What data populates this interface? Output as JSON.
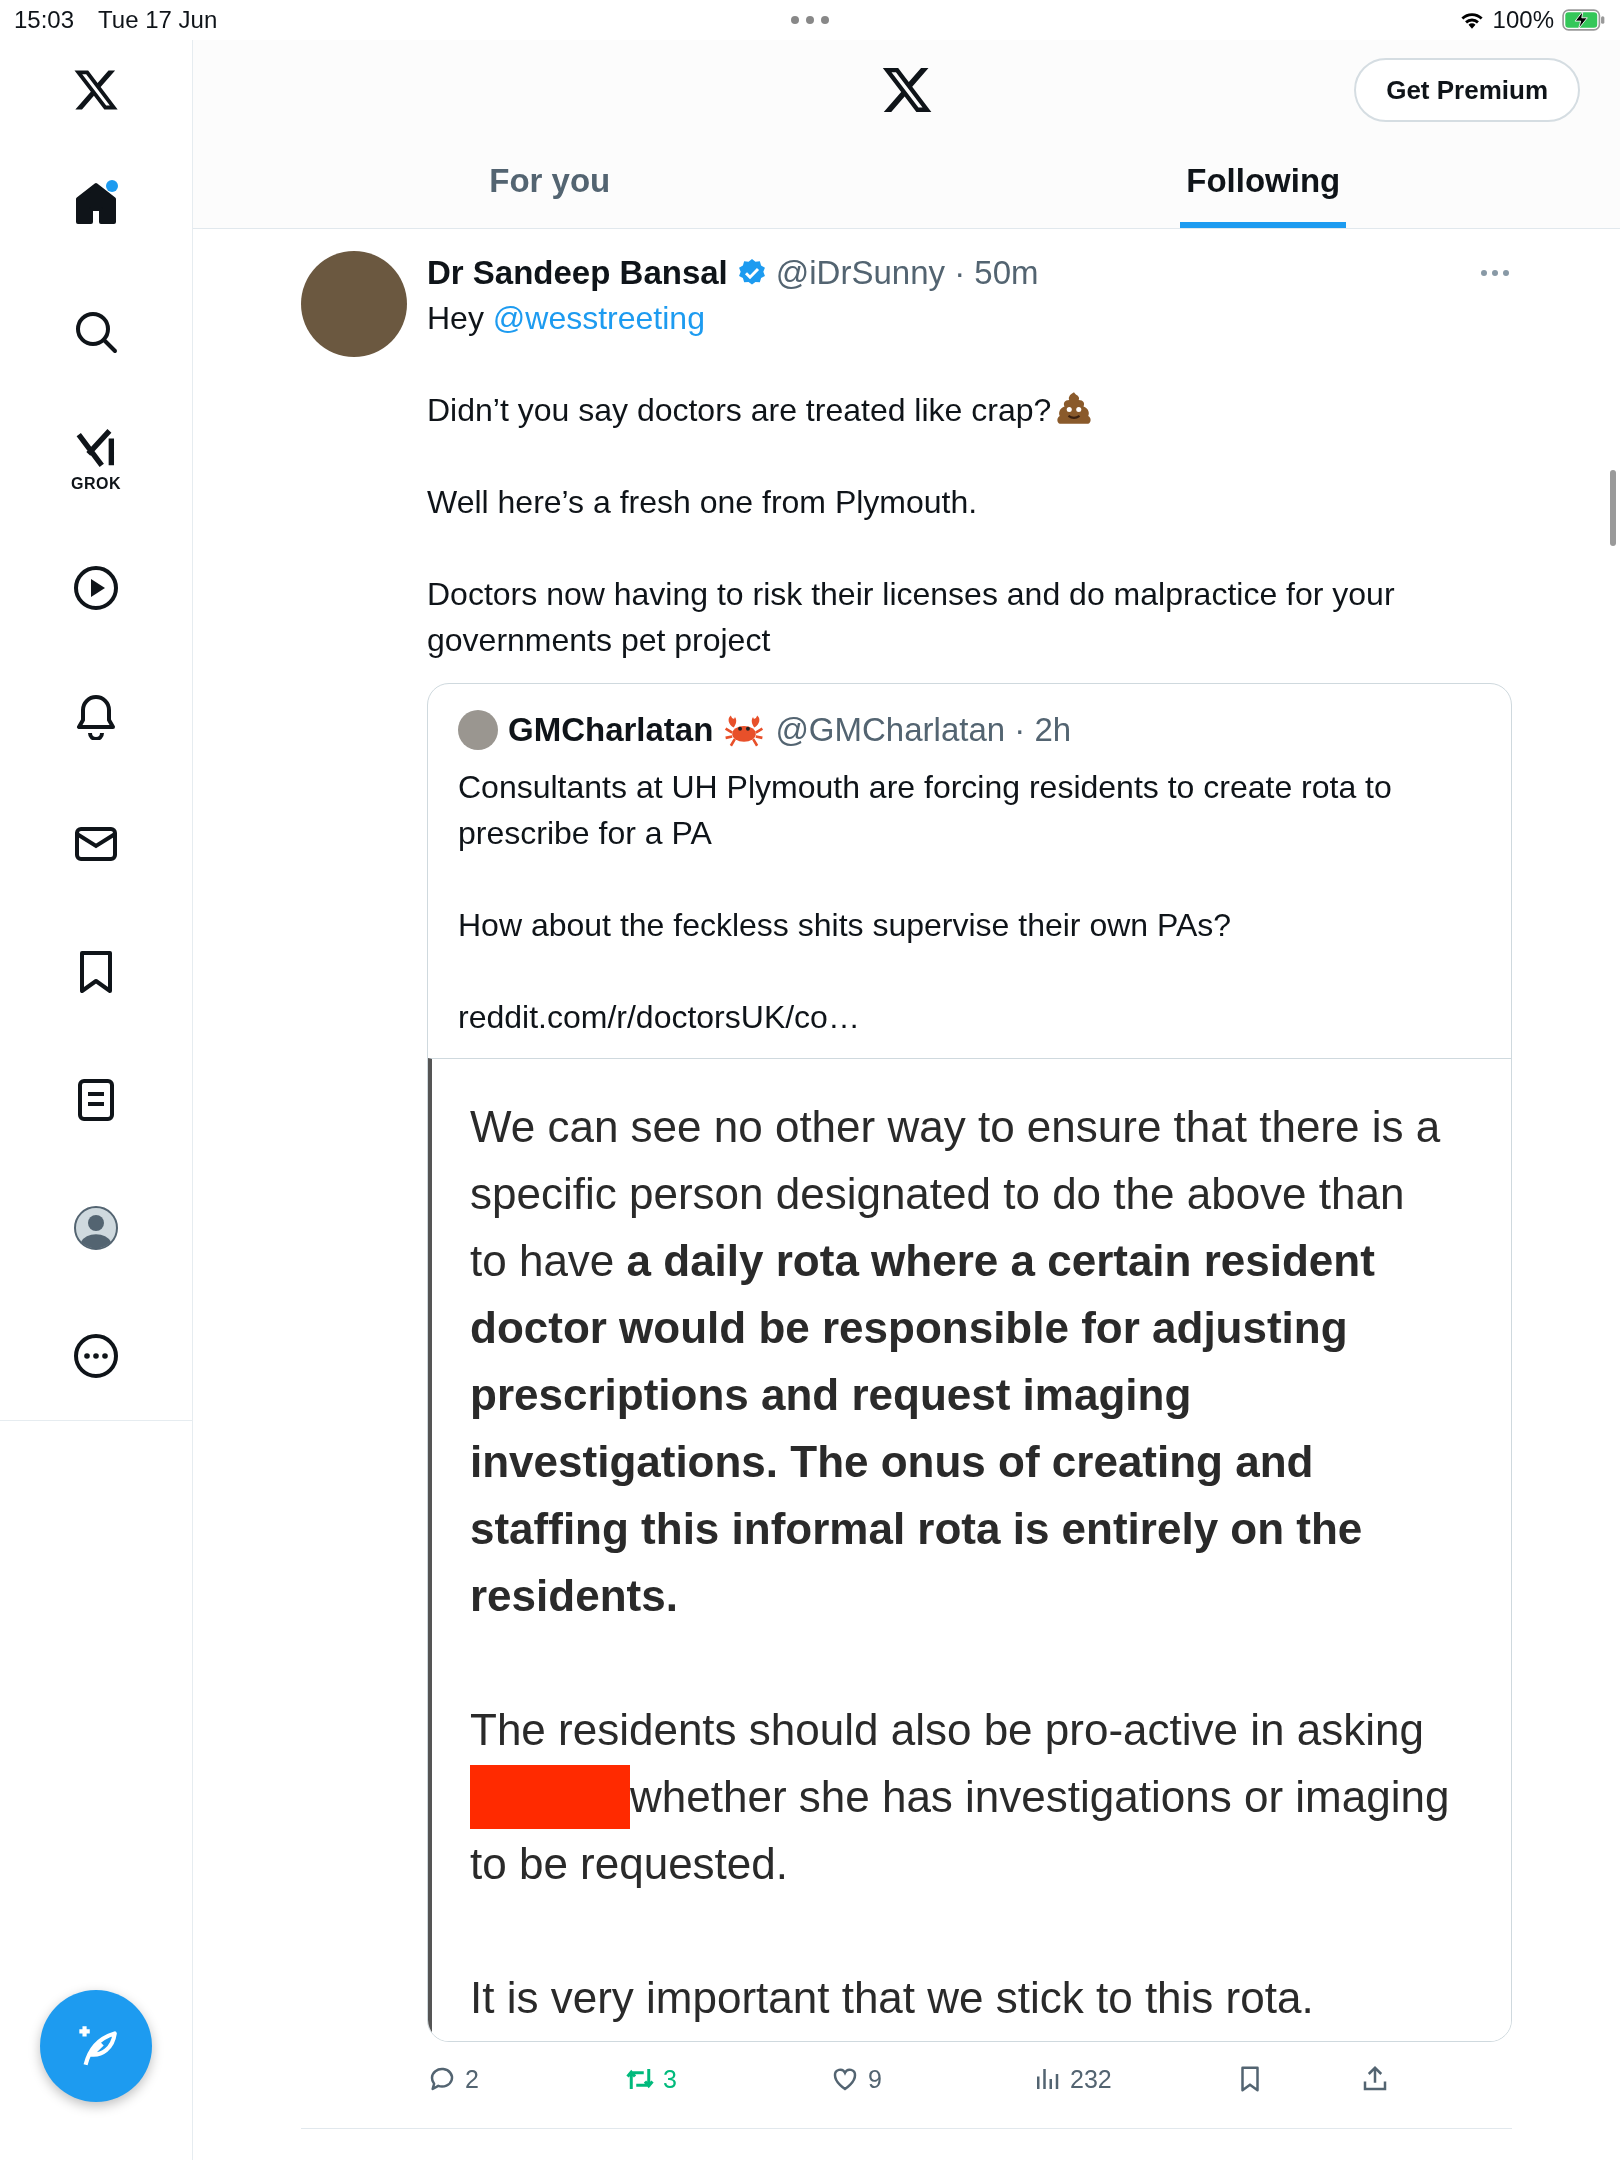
{
  "status_bar": {
    "time": "15:03",
    "date": "Tue 17 Jun",
    "battery": "100%",
    "charging": true
  },
  "sidebar": {
    "items": [
      {
        "kind": "home",
        "selected": true,
        "notification_dot": true
      },
      {
        "kind": "search",
        "selected": false
      },
      {
        "kind": "grok",
        "label": "GROK",
        "selected": false
      },
      {
        "kind": "video",
        "selected": false
      },
      {
        "kind": "notifications",
        "selected": false
      },
      {
        "kind": "messages",
        "selected": false
      },
      {
        "kind": "bookmarks",
        "selected": false
      },
      {
        "kind": "lists",
        "selected": false
      },
      {
        "kind": "profile",
        "selected": false
      },
      {
        "kind": "more",
        "selected": false
      }
    ]
  },
  "header": {
    "premium_button": "Get Premium",
    "tabs": [
      {
        "label": "For you",
        "selected": false
      },
      {
        "label": "Following",
        "selected": true
      }
    ]
  },
  "tweet": {
    "author": {
      "name": "Dr Sandeep Bansal",
      "verified": true,
      "meta": "@iDrSunny · 50m"
    },
    "paragraphs": [
      [
        {
          "kind": "text",
          "text": "Hey "
        },
        {
          "kind": "mention",
          "text": "@wesstreeting"
        }
      ],
      [
        {
          "kind": "text",
          "text": "Didn’t you say doctors are treated like crap?"
        },
        {
          "kind": "poop"
        }
      ],
      [
        {
          "kind": "text",
          "text": "Well here’s a fresh one from Plymouth."
        }
      ],
      [
        {
          "kind": "text",
          "text": "Doctors now having to risk their licenses and do malpractice for your governments pet project"
        }
      ]
    ],
    "quote": {
      "author": {
        "name": "GMCharlatan",
        "meta": "@GMCharlatan · 2h"
      },
      "paragraphs": [
        "Consultants at UH Plymouth are forcing residents to create rota to prescribe for a PA",
        "How about the feckless shits supervise their own PAs?"
      ],
      "link": "reddit.com/r/doctorsUK/co…",
      "document": {
        "paragraphs": [
          [
            {
              "kind": "text",
              "text": "We can see no other way to ensure that there is a specific person designated to do the above than to have **a daily rota where a certain resident doctor would be responsible for adjusting prescriptions and request imaging investigations. The onus of creating and staffing this informal rota is entirely on the residents.**"
            }
          ],
          [
            {
              "kind": "text",
              "text": "The residents should also be pro-active in asking"
            },
            {
              "kind": "redaction"
            },
            {
              "kind": "text",
              "text": "whether she has investigations or imaging"
            },
            {
              "kind": "text",
              "text": "to be requested."
            }
          ],
          [
            {
              "kind": "text",
              "text": "It is very important that we stick to this rota."
            }
          ]
        ]
      }
    },
    "actions": [
      {
        "kind": "reply",
        "count": "2"
      },
      {
        "kind": "repost",
        "count": "3",
        "active": true
      },
      {
        "kind": "like",
        "count": "9",
        "active": false
      },
      {
        "kind": "views",
        "count": "232"
      },
      {
        "kind": "bookmark",
        "active": false
      },
      {
        "kind": "share"
      }
    ]
  }
}
